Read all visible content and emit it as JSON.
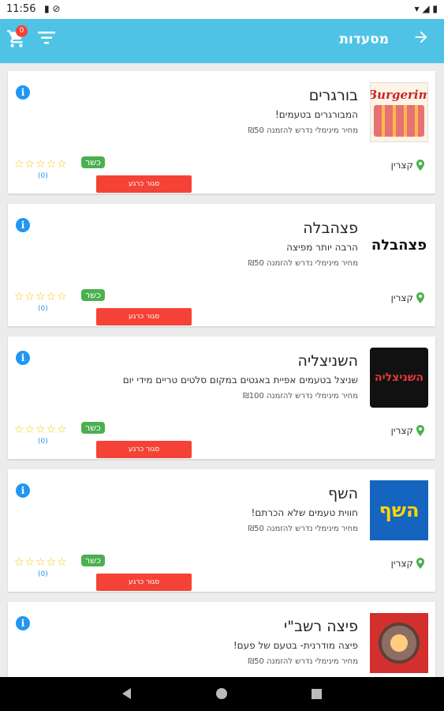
{
  "status": {
    "time": "11:56"
  },
  "appbar": {
    "title": "מסעדות",
    "cart_count": "0"
  },
  "restaurants": [
    {
      "name": "בורגרים",
      "description": "המבורגרים בטעמים!",
      "min_order": "מחיר מינימלי נדרש להזמנה ₪50",
      "logo_text": "Burgerim",
      "city": "קצרין",
      "kosher": "כשר",
      "status": "סגור כרגע",
      "rating_count": "(0)",
      "stars": "☆☆☆☆☆"
    },
    {
      "name": "פצהבלה",
      "description": "הרבה יותר מפיצה",
      "min_order": "מחיר מינימלי נדרש להזמנה ₪50",
      "logo_text": "פצהבלה",
      "city": "קצרין",
      "kosher": "כשר",
      "status": "סגור כרגע",
      "rating_count": "(0)",
      "stars": "☆☆☆☆☆"
    },
    {
      "name": "השניצליה",
      "description": "שניצל בטעמים אפיית באגטים במקום סלטים טריים מידי יום",
      "min_order": "מחיר מינימלי נדרש להזמנה ₪100",
      "logo_text": "השניצליה",
      "city": "קצרין",
      "kosher": "כשר",
      "status": "סגור כרגע",
      "rating_count": "(0)",
      "stars": "☆☆☆☆☆"
    },
    {
      "name": "השף",
      "description": "חווית טעמים שלא הכרתם!",
      "min_order": "מחיר מינימלי נדרש להזמנה ₪50",
      "logo_text": "השף",
      "city": "קצרין",
      "kosher": "כשר",
      "status": "סגור כרגע",
      "rating_count": "(0)",
      "stars": "☆☆☆☆☆"
    },
    {
      "name": "פיצה רשב\"י",
      "description": "פיצה מודרנית- בטעם של פעם!",
      "min_order": "מחיר מינימלי נדרש להזמנה ₪50",
      "logo_text": "",
      "city": "",
      "kosher": "",
      "status": "",
      "rating_count": "",
      "stars": ""
    }
  ],
  "colors": {
    "appbar": "#4fc3e6",
    "closed": "#f44336",
    "kosher": "#4caf50",
    "info": "#2196f3"
  }
}
